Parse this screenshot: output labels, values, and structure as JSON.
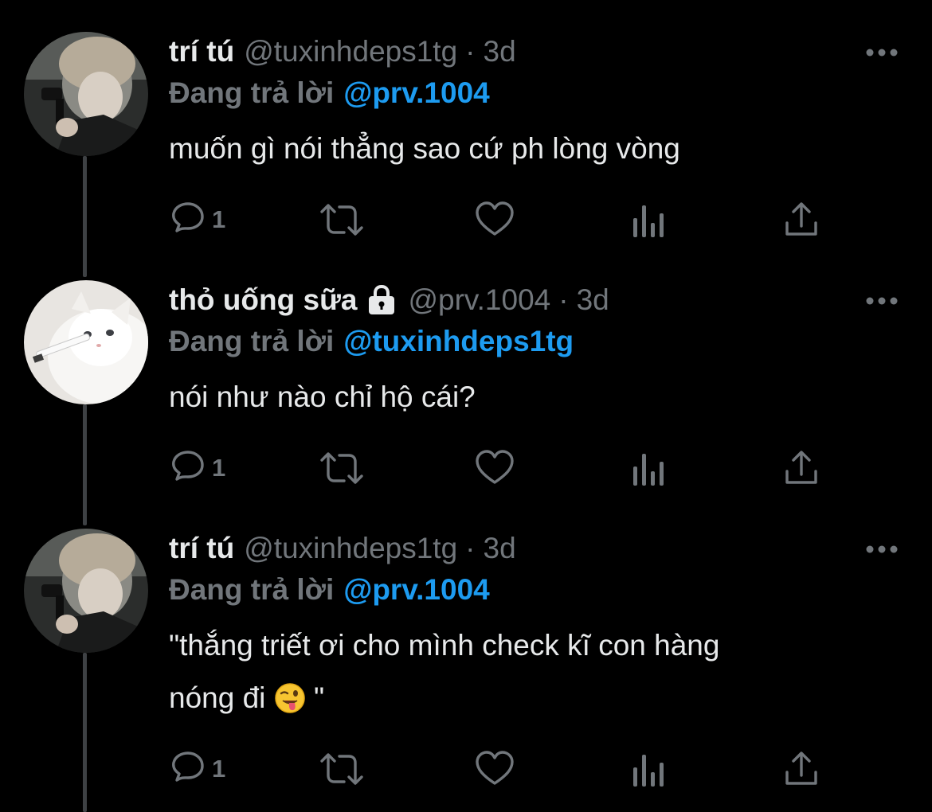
{
  "thread": {
    "tweets": [
      {
        "display_name": "trí tú",
        "handle": "@tuxinhdeps1tg",
        "separator": "·",
        "time": "3d",
        "replying_label": "Đang trả lời",
        "replying_to": "@prv.1004",
        "text": "muốn gì nói thẳng sao cứ ph lòng vòng",
        "reply_count": "1",
        "locked": false,
        "avatar": "avatar-person"
      },
      {
        "display_name": "thỏ uống sữa",
        "handle": "@prv.1004",
        "separator": "·",
        "time": "3d",
        "replying_label": "Đang trả lời",
        "replying_to": "@tuxinhdeps1tg",
        "text": "nói như nào chỉ hộ cái?",
        "reply_count": "1",
        "locked": true,
        "avatar": "avatar-cat"
      },
      {
        "display_name": "trí tú",
        "handle": "@tuxinhdeps1tg",
        "separator": "·",
        "time": "3d",
        "replying_label": "Đang trả lời",
        "replying_to": "@prv.1004",
        "text_line1": "\"thắng triết ơi cho mình check kĩ con hàng",
        "text_line2_before": "nóng đi ",
        "text_line2_after": " \"",
        "emoji": "winking-face-with-tongue",
        "reply_count": "1",
        "locked": false,
        "avatar": "avatar-person"
      }
    ]
  },
  "icons": {
    "reply": "reply-icon",
    "retweet": "retweet-icon",
    "like": "heart-icon",
    "analytics": "analytics-icon",
    "share": "share-icon",
    "more": "more-icon",
    "lock": "lock-icon"
  },
  "colors": {
    "background": "#000000",
    "text": "#e7e9ea",
    "secondary": "#71767b",
    "link": "#1d9bf0",
    "thread_line": "#3e4144"
  }
}
